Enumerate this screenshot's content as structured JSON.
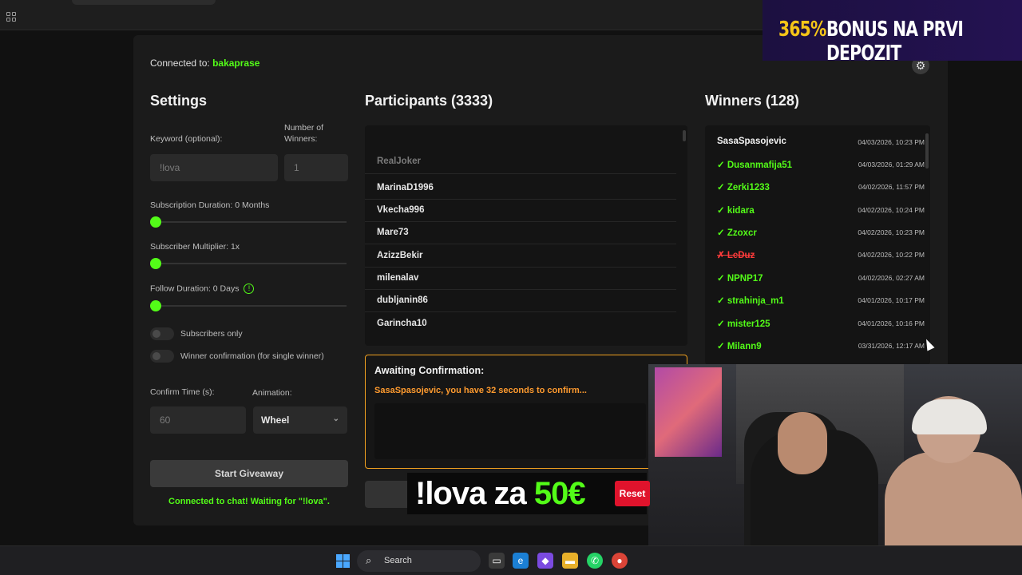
{
  "connection": {
    "prefix": "Connected to:",
    "channel": "bakaprase"
  },
  "settings": {
    "title": "Settings",
    "keyword_label": "Keyword (optional):",
    "keyword_value": "!lova",
    "winners_label_1": "Number of",
    "winners_label_2": "Winners:",
    "winners_value": "1",
    "subscription_label": "Subscription Duration: 0 Months",
    "multiplier_label": "Subscriber Multiplier: 1x",
    "follow_label": "Follow Duration:  0  Days",
    "info_glyph": "!",
    "subs_only_label": "Subscribers only",
    "winner_confirm_label": "Winner confirmation (for single winner)",
    "confirm_time_label": "Confirm Time (s):",
    "confirm_time_value": "60",
    "animation_label": "Animation:",
    "animation_value": "Wheel",
    "start_button": "Start Giveaway",
    "chat_status": "Connected to chat! Waiting for \"!lova\"."
  },
  "participants": {
    "title": "Participants (3333)",
    "faded": "RealJoker",
    "items": [
      "MarinaD1996",
      "Vkecha996",
      "Mare73",
      "AzizzBekir",
      "milenalav",
      "dubljanin86",
      "Garincha10"
    ]
  },
  "winners": {
    "title": "Winners (128)",
    "items": [
      {
        "name": "SasaSpasojevic",
        "date": "04/03/2026, 10:23 PM",
        "status": "pending"
      },
      {
        "name": "Dusanmafija51",
        "date": "04/03/2026, 01:29 AM",
        "status": "confirmed"
      },
      {
        "name": "Zerki1233",
        "date": "04/02/2026, 11:57 PM",
        "status": "confirmed"
      },
      {
        "name": "kidara",
        "date": "04/02/2026, 10:24 PM",
        "status": "confirmed"
      },
      {
        "name": "Zzoxcr",
        "date": "04/02/2026, 10:23 PM",
        "status": "confirmed"
      },
      {
        "name": "LeDuz",
        "date": "04/02/2026, 10:22 PM",
        "status": "rejected"
      },
      {
        "name": "NPNP17",
        "date": "04/02/2026, 02:27 AM",
        "status": "confirmed"
      },
      {
        "name": "strahinja_m1",
        "date": "04/01/2026, 10:17 PM",
        "status": "confirmed"
      },
      {
        "name": "mister125",
        "date": "04/01/2026, 10:16 PM",
        "status": "confirmed"
      },
      {
        "name": "Milann9",
        "date": "03/31/2026, 12:17 AM",
        "status": "confirmed"
      }
    ],
    "check": "✓",
    "cross": "✗"
  },
  "awaiting": {
    "title": "Awaiting Confirmation:",
    "message": "SasaSpasojevic, you have 32 seconds to confirm..."
  },
  "overlay": {
    "text_a": "!lova za ",
    "text_b": "50€",
    "reset": "Reset"
  },
  "promo": {
    "a": "365%",
    "b": "BONUS NA PRVI DEPOZIT"
  },
  "taskbar": {
    "search": "Search"
  },
  "colors": {
    "accent": "#53fc18",
    "warning": "#ff9b2f",
    "reject": "#ff3b3b"
  }
}
